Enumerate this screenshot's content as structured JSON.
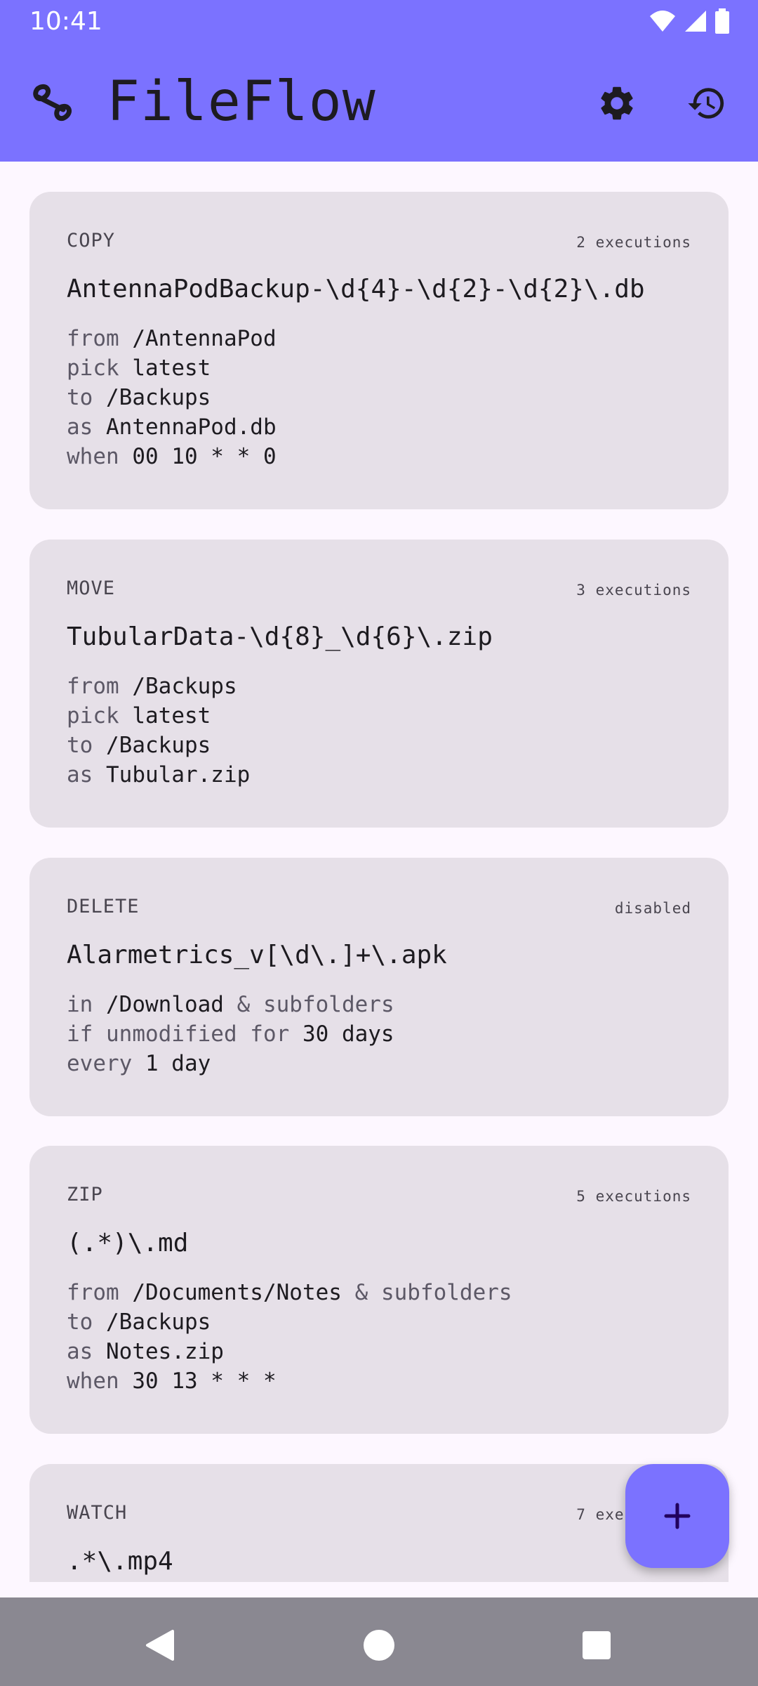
{
  "status_bar": {
    "time": "10:41"
  },
  "app_bar": {
    "title": "FileFlow",
    "settings_icon": "gear-icon",
    "history_icon": "history-icon"
  },
  "rules": [
    {
      "type": "COPY",
      "status": "2 executions",
      "pattern": "AntennaPodBackup-\\d{4}-\\d{2}-\\d{2}\\.db",
      "lines": [
        {
          "kw": "from ",
          "val": "/AntennaPod"
        },
        {
          "kw": "pick ",
          "val": "latest"
        },
        {
          "kw": "to ",
          "val": "/Backups"
        },
        {
          "kw": "as ",
          "val": "AntennaPod.db"
        },
        {
          "kw": "when ",
          "val": "00 10 * * 0"
        }
      ]
    },
    {
      "type": "MOVE",
      "status": "3 executions",
      "pattern": "TubularData-\\d{8}_\\d{6}\\.zip",
      "lines": [
        {
          "kw": "from ",
          "val": "/Backups"
        },
        {
          "kw": "pick ",
          "val": "latest"
        },
        {
          "kw": "to ",
          "val": "/Backups"
        },
        {
          "kw": "as ",
          "val": "Tubular.zip"
        }
      ]
    },
    {
      "type": "DELETE",
      "status": "disabled",
      "pattern": "Alarmetrics_v[\\d\\.]+\\.apk",
      "lines": [
        {
          "kw": "in ",
          "val": "/Download",
          "tail": " & subfolders"
        },
        {
          "kw": "if unmodified for ",
          "val": "30 days"
        },
        {
          "kw": "every ",
          "val": "1 day"
        }
      ]
    },
    {
      "type": "ZIP",
      "status": "5 executions",
      "pattern": "(.*)\\.md",
      "lines": [
        {
          "kw": "from ",
          "val": "/Documents/Notes",
          "tail": " & subfolders"
        },
        {
          "kw": "to ",
          "val": "/Backups"
        },
        {
          "kw": "as ",
          "val": "Notes.zip"
        },
        {
          "kw": "when ",
          "val": "30 13 * * *"
        }
      ]
    },
    {
      "type": "WATCH",
      "status": "7 executions",
      "pattern": ".*\\.mp4",
      "lines": []
    }
  ],
  "fab": {
    "icon": "plus-icon"
  },
  "nav_bar": {
    "back": "back-icon",
    "home": "home-icon",
    "recents": "recents-icon"
  },
  "colors": {
    "accent": "#7b72ff",
    "card": "#e6e0e8",
    "background": "#fdf7ff",
    "nav": "#8a8891"
  }
}
